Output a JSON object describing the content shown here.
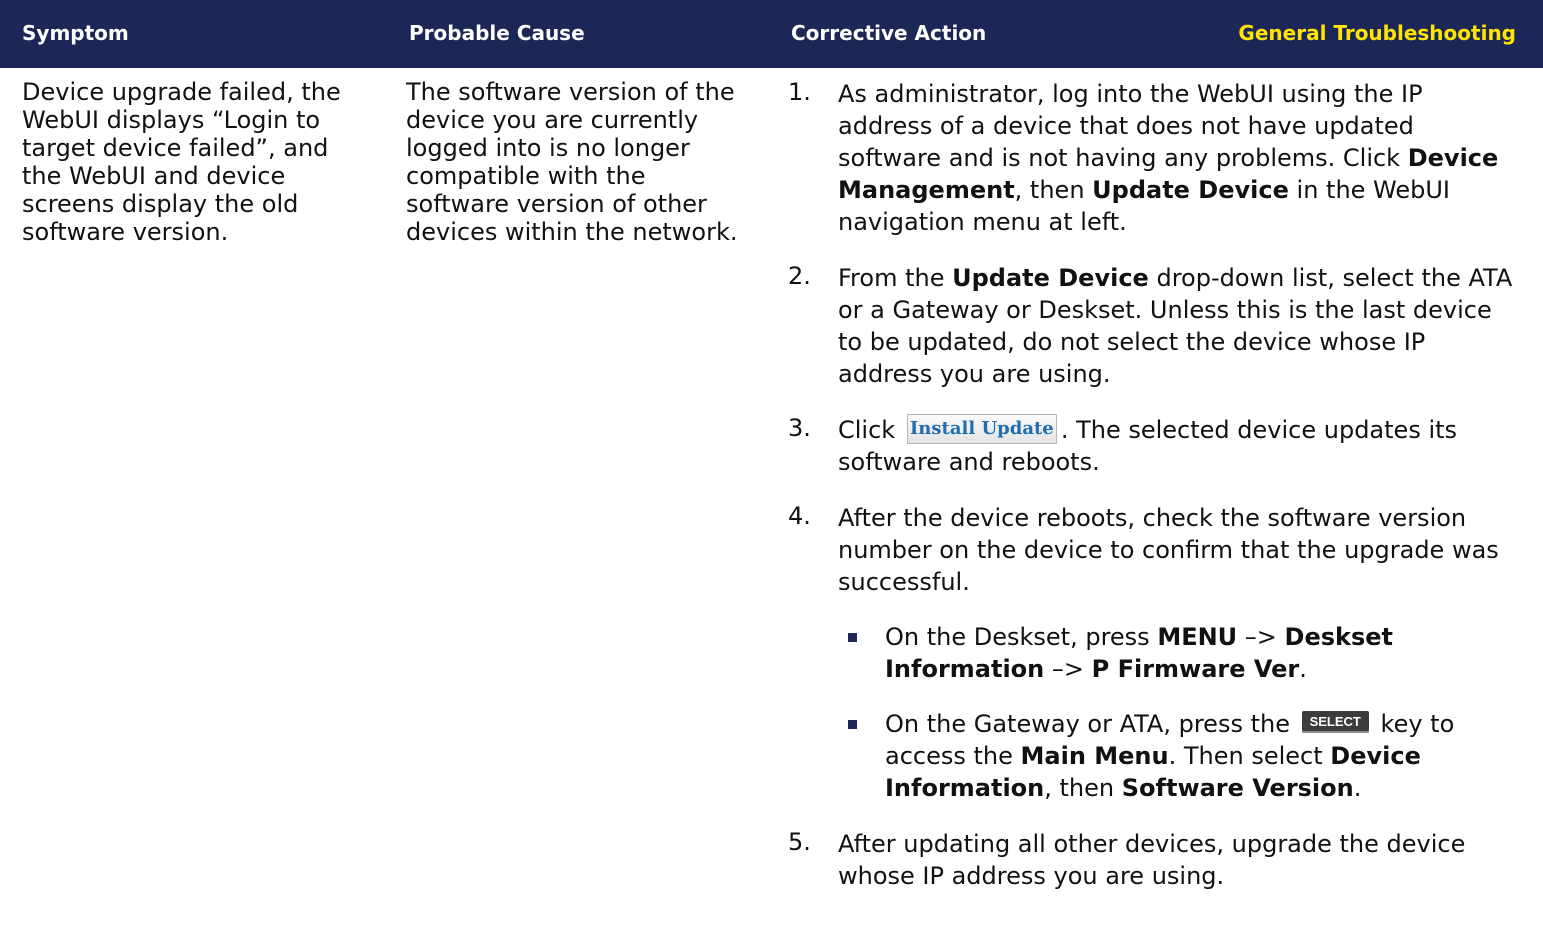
{
  "header": {
    "symptom": "Symptom",
    "cause": "Probable Cause",
    "action": "Corrective Action",
    "section": "General Troubleshooting"
  },
  "symptom_text": "Device upgrade failed, the WebUI displays “Login to target device failed”, and the WebUI and device screens display the old software version.",
  "cause_text": "The software version of the device you are currently logged into is no longer compatible with the software version of other devices within the network.",
  "steps": {
    "s1": {
      "num": "1.",
      "t1": "As administrator, log into the WebUI using the IP address of a device that does not have updated software and is not having any problems. Click ",
      "b1": "Device Management",
      "t2": ", then ",
      "b2": "Update Device",
      "t3": " in the WebUI navigation menu at left."
    },
    "s2": {
      "num": "2.",
      "t1": "From the ",
      "b1": "Update Device",
      "t2": " drop-down list, select the ATA or a Gateway or Deskset. Unless this is the last device to be updated, do not select the device whose IP address you are using."
    },
    "s3": {
      "num": "3.",
      "t1": "Click ",
      "button": "Install Update",
      "t2": ". The selected device updates its software and reboots."
    },
    "s4": {
      "num": "4.",
      "t1": "After the device reboots, check the software version number on the device to confirm that the upgrade was successful."
    },
    "s5": {
      "num": "5.",
      "t1": "After updating all other devices, upgrade the device whose IP address you are using."
    }
  },
  "bullets": {
    "b1": {
      "t1": "On the Deskset, press ",
      "k1": "MENU",
      "t2": " –> ",
      "k2": "Deskset Information",
      "t3": " –> ",
      "k3": "P Firmware Ver",
      "t4": "."
    },
    "b2": {
      "t1": "On the Gateway or ATA, press the ",
      "key": "SELECT",
      "t2": " key to access the ",
      "k1": "Main Menu",
      "t3": ". Then select ",
      "k2": "Device Information",
      "t4": ", then ",
      "k3": "Software Version",
      "t5": "."
    }
  },
  "colors": {
    "header_bg": "#1d2757",
    "header_text": "#ffffff",
    "section_label": "#ffe500",
    "bullet": "#1d2757"
  }
}
